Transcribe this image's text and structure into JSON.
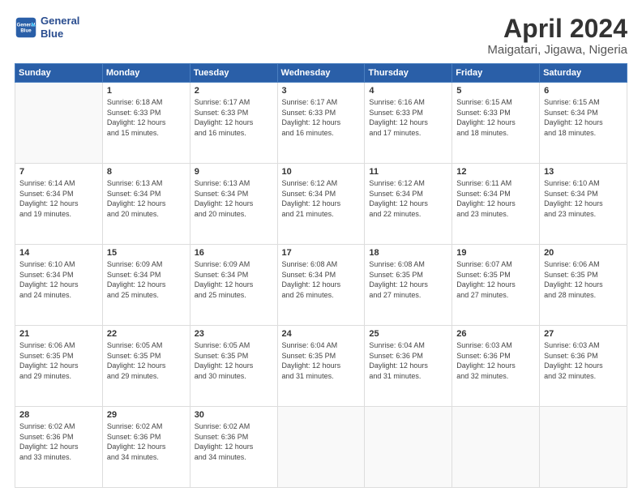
{
  "logo": {
    "line1": "General",
    "line2": "Blue"
  },
  "title": "April 2024",
  "subtitle": "Maigatari, Jigawa, Nigeria",
  "weekdays": [
    "Sunday",
    "Monday",
    "Tuesday",
    "Wednesday",
    "Thursday",
    "Friday",
    "Saturday"
  ],
  "weeks": [
    [
      {
        "day": "",
        "info": ""
      },
      {
        "day": "1",
        "info": "Sunrise: 6:18 AM\nSunset: 6:33 PM\nDaylight: 12 hours\nand 15 minutes."
      },
      {
        "day": "2",
        "info": "Sunrise: 6:17 AM\nSunset: 6:33 PM\nDaylight: 12 hours\nand 16 minutes."
      },
      {
        "day": "3",
        "info": "Sunrise: 6:17 AM\nSunset: 6:33 PM\nDaylight: 12 hours\nand 16 minutes."
      },
      {
        "day": "4",
        "info": "Sunrise: 6:16 AM\nSunset: 6:33 PM\nDaylight: 12 hours\nand 17 minutes."
      },
      {
        "day": "5",
        "info": "Sunrise: 6:15 AM\nSunset: 6:33 PM\nDaylight: 12 hours\nand 18 minutes."
      },
      {
        "day": "6",
        "info": "Sunrise: 6:15 AM\nSunset: 6:34 PM\nDaylight: 12 hours\nand 18 minutes."
      }
    ],
    [
      {
        "day": "7",
        "info": "Sunrise: 6:14 AM\nSunset: 6:34 PM\nDaylight: 12 hours\nand 19 minutes."
      },
      {
        "day": "8",
        "info": "Sunrise: 6:13 AM\nSunset: 6:34 PM\nDaylight: 12 hours\nand 20 minutes."
      },
      {
        "day": "9",
        "info": "Sunrise: 6:13 AM\nSunset: 6:34 PM\nDaylight: 12 hours\nand 20 minutes."
      },
      {
        "day": "10",
        "info": "Sunrise: 6:12 AM\nSunset: 6:34 PM\nDaylight: 12 hours\nand 21 minutes."
      },
      {
        "day": "11",
        "info": "Sunrise: 6:12 AM\nSunset: 6:34 PM\nDaylight: 12 hours\nand 22 minutes."
      },
      {
        "day": "12",
        "info": "Sunrise: 6:11 AM\nSunset: 6:34 PM\nDaylight: 12 hours\nand 23 minutes."
      },
      {
        "day": "13",
        "info": "Sunrise: 6:10 AM\nSunset: 6:34 PM\nDaylight: 12 hours\nand 23 minutes."
      }
    ],
    [
      {
        "day": "14",
        "info": "Sunrise: 6:10 AM\nSunset: 6:34 PM\nDaylight: 12 hours\nand 24 minutes."
      },
      {
        "day": "15",
        "info": "Sunrise: 6:09 AM\nSunset: 6:34 PM\nDaylight: 12 hours\nand 25 minutes."
      },
      {
        "day": "16",
        "info": "Sunrise: 6:09 AM\nSunset: 6:34 PM\nDaylight: 12 hours\nand 25 minutes."
      },
      {
        "day": "17",
        "info": "Sunrise: 6:08 AM\nSunset: 6:34 PM\nDaylight: 12 hours\nand 26 minutes."
      },
      {
        "day": "18",
        "info": "Sunrise: 6:08 AM\nSunset: 6:35 PM\nDaylight: 12 hours\nand 27 minutes."
      },
      {
        "day": "19",
        "info": "Sunrise: 6:07 AM\nSunset: 6:35 PM\nDaylight: 12 hours\nand 27 minutes."
      },
      {
        "day": "20",
        "info": "Sunrise: 6:06 AM\nSunset: 6:35 PM\nDaylight: 12 hours\nand 28 minutes."
      }
    ],
    [
      {
        "day": "21",
        "info": "Sunrise: 6:06 AM\nSunset: 6:35 PM\nDaylight: 12 hours\nand 29 minutes."
      },
      {
        "day": "22",
        "info": "Sunrise: 6:05 AM\nSunset: 6:35 PM\nDaylight: 12 hours\nand 29 minutes."
      },
      {
        "day": "23",
        "info": "Sunrise: 6:05 AM\nSunset: 6:35 PM\nDaylight: 12 hours\nand 30 minutes."
      },
      {
        "day": "24",
        "info": "Sunrise: 6:04 AM\nSunset: 6:35 PM\nDaylight: 12 hours\nand 31 minutes."
      },
      {
        "day": "25",
        "info": "Sunrise: 6:04 AM\nSunset: 6:36 PM\nDaylight: 12 hours\nand 31 minutes."
      },
      {
        "day": "26",
        "info": "Sunrise: 6:03 AM\nSunset: 6:36 PM\nDaylight: 12 hours\nand 32 minutes."
      },
      {
        "day": "27",
        "info": "Sunrise: 6:03 AM\nSunset: 6:36 PM\nDaylight: 12 hours\nand 32 minutes."
      }
    ],
    [
      {
        "day": "28",
        "info": "Sunrise: 6:02 AM\nSunset: 6:36 PM\nDaylight: 12 hours\nand 33 minutes."
      },
      {
        "day": "29",
        "info": "Sunrise: 6:02 AM\nSunset: 6:36 PM\nDaylight: 12 hours\nand 34 minutes."
      },
      {
        "day": "30",
        "info": "Sunrise: 6:02 AM\nSunset: 6:36 PM\nDaylight: 12 hours\nand 34 minutes."
      },
      {
        "day": "",
        "info": ""
      },
      {
        "day": "",
        "info": ""
      },
      {
        "day": "",
        "info": ""
      },
      {
        "day": "",
        "info": ""
      }
    ]
  ]
}
